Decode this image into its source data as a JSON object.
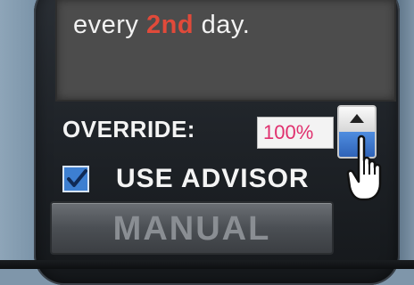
{
  "message": {
    "prefix": "every ",
    "highlight": "2nd",
    "suffix": " day."
  },
  "override": {
    "label": "OVERRIDE:",
    "value": "100%"
  },
  "advisor": {
    "label": "USE ADVISOR",
    "checked": true
  },
  "manual_button": {
    "label": "MANUAL"
  },
  "icons": {
    "spinner_up": "triangle-up-icon",
    "checkmark": "checkmark-icon",
    "cursor": "hand-pointer-icon"
  },
  "colors": {
    "highlight": "#e04a3a",
    "override_value": "#e0306e",
    "checkbox": "#3d7fd1",
    "spinner_down": "#3f77cc"
  }
}
